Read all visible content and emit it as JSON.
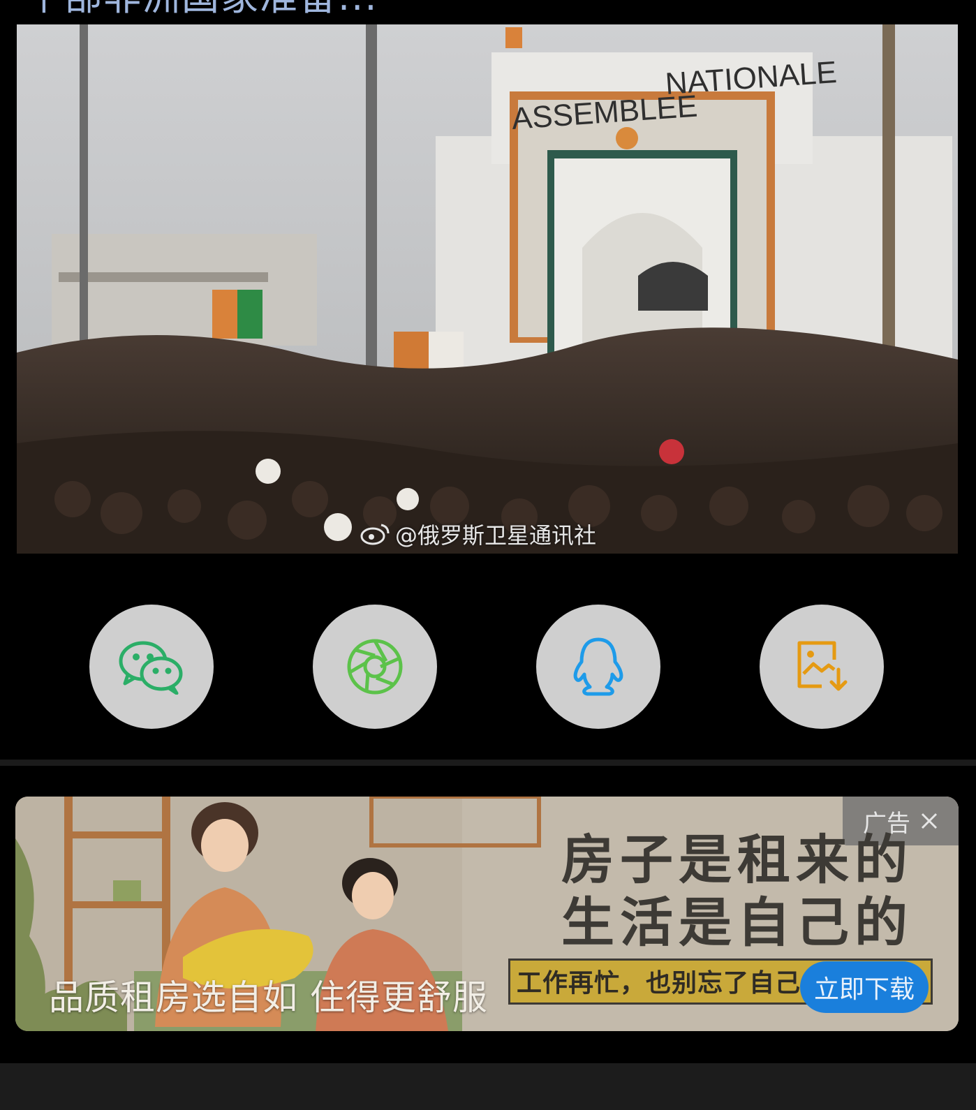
{
  "article": {
    "headline_partial": "个部非洲国家准备...",
    "photo": {
      "building_sign_left": "ASSEMBLEE",
      "building_sign_right": "NATIONALE",
      "watermark": "@俄罗斯卫星通讯社"
    }
  },
  "share": {
    "buttons": [
      {
        "name": "wechat",
        "icon": "wechat-icon",
        "color": "#2bae67"
      },
      {
        "name": "moments",
        "icon": "aperture-icon",
        "color": "#5cc24a"
      },
      {
        "name": "qq",
        "icon": "qq-penguin-icon",
        "color": "#1e9be9"
      },
      {
        "name": "save-image",
        "icon": "image-download-icon",
        "color": "#e59a12"
      }
    ]
  },
  "ad": {
    "label": "广告",
    "headline_line1": "房子是租来的",
    "headline_line2": "生活是自己的",
    "subline": "工作再忙，也别忘了自己",
    "tagline": "品质租房选自如 住得更舒服",
    "cta": "立即下载",
    "colors": {
      "cta": "#1a7fdc",
      "highlight": "#c9a93a"
    }
  }
}
